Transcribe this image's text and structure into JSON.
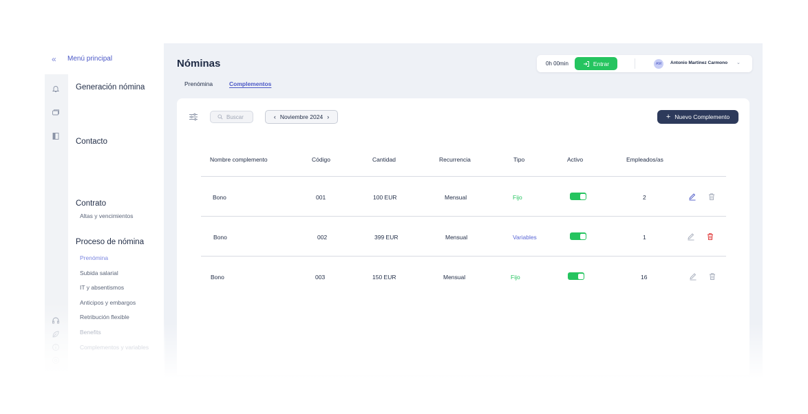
{
  "sidebar": {
    "collapse_icon": "double-chevron-left-icon",
    "menu_title": "Menú principal",
    "sections": [
      {
        "title": "Generación nómina"
      },
      {
        "title": "Contacto"
      },
      {
        "title": "Contrato",
        "items": [
          "Altas y vencimientos"
        ]
      },
      {
        "title": "Proceso de nómina",
        "items": [
          "Prenómina",
          "Subida salarial",
          "IT y absentismos",
          "Anticipos y embargos",
          "Retribución flexible",
          "Benefits",
          "Complementos y variables"
        ]
      }
    ],
    "active_item": "Prenómina",
    "rail_icons": [
      "bell-icon",
      "chat-icon",
      "sidebar-toggle-icon",
      "headset-icon",
      "leaf-icon",
      "info-icon",
      "settings-icon"
    ]
  },
  "header": {
    "title": "Nóminas",
    "tabs": [
      "Prenómina",
      "Complementos"
    ],
    "active_tab": "Complementos"
  },
  "topbar": {
    "timer": "0h 00min",
    "entrar_label": "Entrar",
    "avatar_initials": "AM",
    "user_name": "Antonio Martinez Carmono"
  },
  "toolbar": {
    "search_placeholder": "Buscar",
    "month": "Noviembre 2024",
    "new_button": "Nuevo Complemento"
  },
  "table": {
    "columns": [
      "Nombre complemento",
      "Código",
      "Cantidad",
      "Recurrencia",
      "Tipo",
      "Activo",
      "Empleados/as"
    ],
    "rows": [
      {
        "nombre": "Bono",
        "codigo": "001",
        "cantidad": "100 EUR",
        "recurrencia": "Mensual",
        "tipo": "Fijo",
        "activo": true,
        "empleados": "2"
      },
      {
        "nombre": "Bono",
        "codigo": "002",
        "cantidad": "399 EUR",
        "recurrencia": "Mensual",
        "tipo": "Variables",
        "activo": true,
        "empleados": "1"
      },
      {
        "nombre": "Bono",
        "codigo": "003",
        "cantidad": "150 EUR",
        "recurrencia": "Mensual",
        "tipo": "Fijo",
        "activo": true,
        "empleados": "16"
      }
    ]
  },
  "colors": {
    "accent": "#4a57c6",
    "success": "#25c45f",
    "primary_dark": "#2d3a5b",
    "danger": "#e03a3a",
    "background": "#eef1f6"
  }
}
